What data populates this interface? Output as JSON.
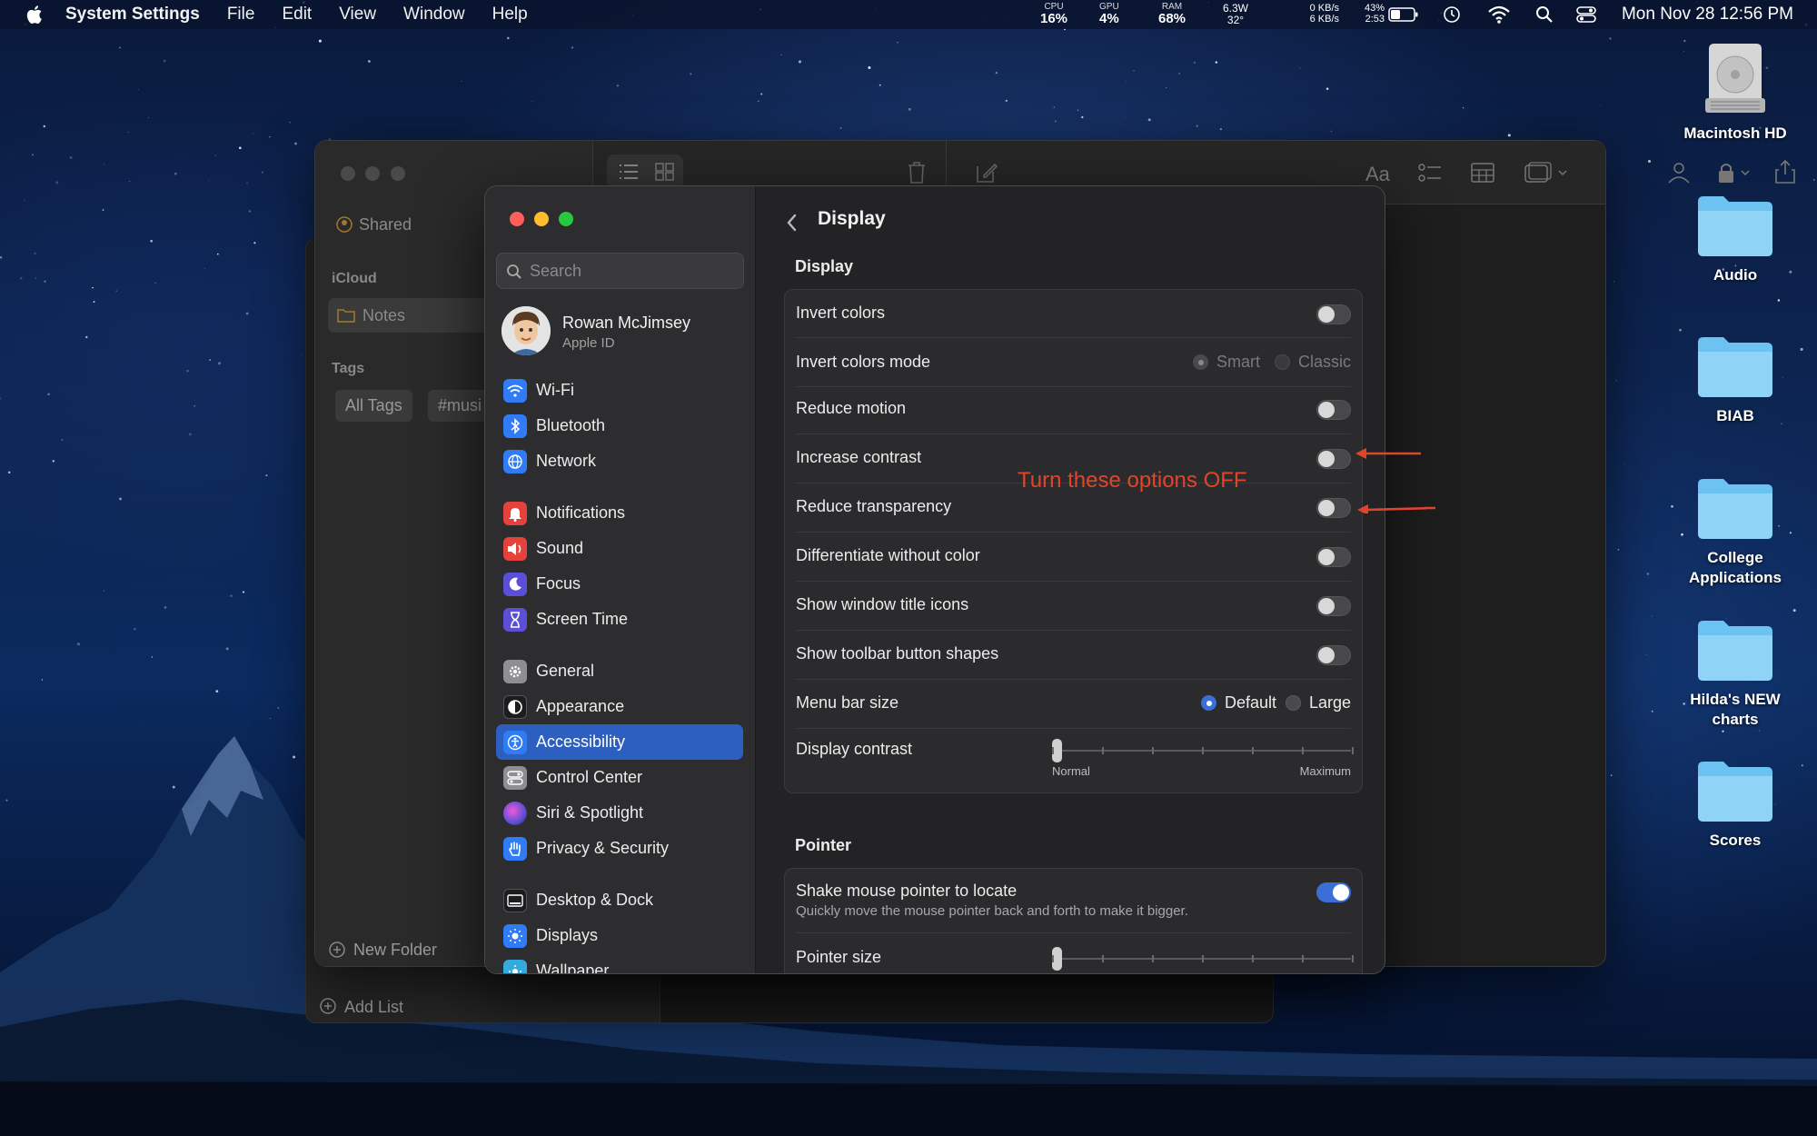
{
  "menubar": {
    "app_name": "System Settings",
    "menus": [
      "File",
      "Edit",
      "View",
      "Window",
      "Help"
    ],
    "stats": [
      {
        "label": "CPU",
        "value": "16%"
      },
      {
        "label": "GPU",
        "value": "4%"
      },
      {
        "label": "RAM",
        "value": "68%"
      }
    ],
    "power": {
      "watts": "6.3W",
      "temp": "32°"
    },
    "network": {
      "up": "0 KB/s",
      "down": "6 KB/s"
    },
    "battery": {
      "percent": "43%",
      "time": "2:53"
    },
    "clock": "Mon Nov 28  12:56 PM"
  },
  "desktop": {
    "items": [
      {
        "label": "Macintosh HD",
        "icon": "hard-drive-icon"
      },
      {
        "label": "Audio",
        "icon": "folder-icon"
      },
      {
        "label": "BIAB",
        "icon": "folder-icon"
      },
      {
        "label_line1": "College",
        "label_line2": "Applications",
        "icon": "folder-icon"
      },
      {
        "label_line1": "Hilda's NEW",
        "label_line2": "charts",
        "icon": "folder-icon"
      },
      {
        "label": "Scores",
        "icon": "folder-icon"
      }
    ]
  },
  "notes": {
    "shared": "Shared",
    "icloud": "iCloud",
    "notes_folder": "Notes",
    "tags": "Tags",
    "all_tags": "All Tags",
    "tag_music": "#musi",
    "new_folder": "New Folder",
    "add_list": "Add List"
  },
  "settings": {
    "search_placeholder": "Search",
    "profile": {
      "name": "Rowan McJimsey",
      "subtitle": "Apple ID"
    },
    "sidebar": [
      {
        "label": "Wi-Fi",
        "icon": "wifi-icon",
        "color": "#2f7cf6"
      },
      {
        "label": "Bluetooth",
        "icon": "bluetooth-icon",
        "color": "#2f7cf6"
      },
      {
        "label": "Network",
        "icon": "globe-icon",
        "color": "#2f7cf6"
      },
      {
        "label": "Notifications",
        "icon": "bell-icon",
        "color": "#e5423b"
      },
      {
        "label": "Sound",
        "icon": "speaker-icon",
        "color": "#e5423b"
      },
      {
        "label": "Focus",
        "icon": "moon-icon",
        "color": "#5a4fd6"
      },
      {
        "label": "Screen Time",
        "icon": "hourglass-icon",
        "color": "#5a4fd6"
      },
      {
        "label": "General",
        "icon": "gear-icon",
        "color": "#8e8e93"
      },
      {
        "label": "Appearance",
        "icon": "appearance-icon",
        "color": "#1c1c1e"
      },
      {
        "label": "Accessibility",
        "icon": "accessibility-icon",
        "color": "#2f7cf6"
      },
      {
        "label": "Control Center",
        "icon": "control-center-icon",
        "color": "#8e8e93"
      },
      {
        "label": "Siri & Spotlight",
        "icon": "siri-icon",
        "color": "#b045d6"
      },
      {
        "label": "Privacy & Security",
        "icon": "hand-icon",
        "color": "#2f7cf6"
      },
      {
        "label": "Desktop & Dock",
        "icon": "dock-icon",
        "color": "#1c1c1e"
      },
      {
        "label": "Displays",
        "icon": "sun-icon",
        "color": "#2f7cf6"
      },
      {
        "label": "Wallpaper",
        "icon": "wallpaper-icon",
        "color": "#35aadc"
      }
    ],
    "active_item": "Accessibility",
    "main": {
      "title": "Display",
      "display_section": "Display",
      "rows": {
        "invert_colors": {
          "label": "Invert colors",
          "on": false
        },
        "invert_mode": {
          "label": "Invert colors mode",
          "options": [
            "Smart",
            "Classic"
          ],
          "selected": "Smart"
        },
        "reduce_motion": {
          "label": "Reduce motion",
          "on": false
        },
        "increase_contrast": {
          "label": "Increase contrast",
          "on": false
        },
        "reduce_transparency": {
          "label": "Reduce transparency",
          "on": false
        },
        "differentiate": {
          "label": "Differentiate without color",
          "on": false
        },
        "window_title_icons": {
          "label": "Show window title icons",
          "on": false
        },
        "toolbar_shapes": {
          "label": "Show toolbar button shapes",
          "on": false
        },
        "menu_bar_size": {
          "label": "Menu bar size",
          "options": [
            "Default",
            "Large"
          ],
          "selected": "Default"
        },
        "display_contrast": {
          "label": "Display contrast",
          "min_label": "Normal",
          "max_label": "Maximum",
          "value": 0
        }
      },
      "pointer_section": "Pointer",
      "pointer_rows": {
        "shake": {
          "label": "Shake mouse pointer to locate",
          "description": "Quickly move the mouse pointer back and forth to make it bigger.",
          "on": true
        },
        "pointer_size": {
          "label": "Pointer size",
          "value": 0
        }
      }
    }
  },
  "annotation": {
    "text": "Turn these options OFF",
    "color": "#e0452c"
  }
}
